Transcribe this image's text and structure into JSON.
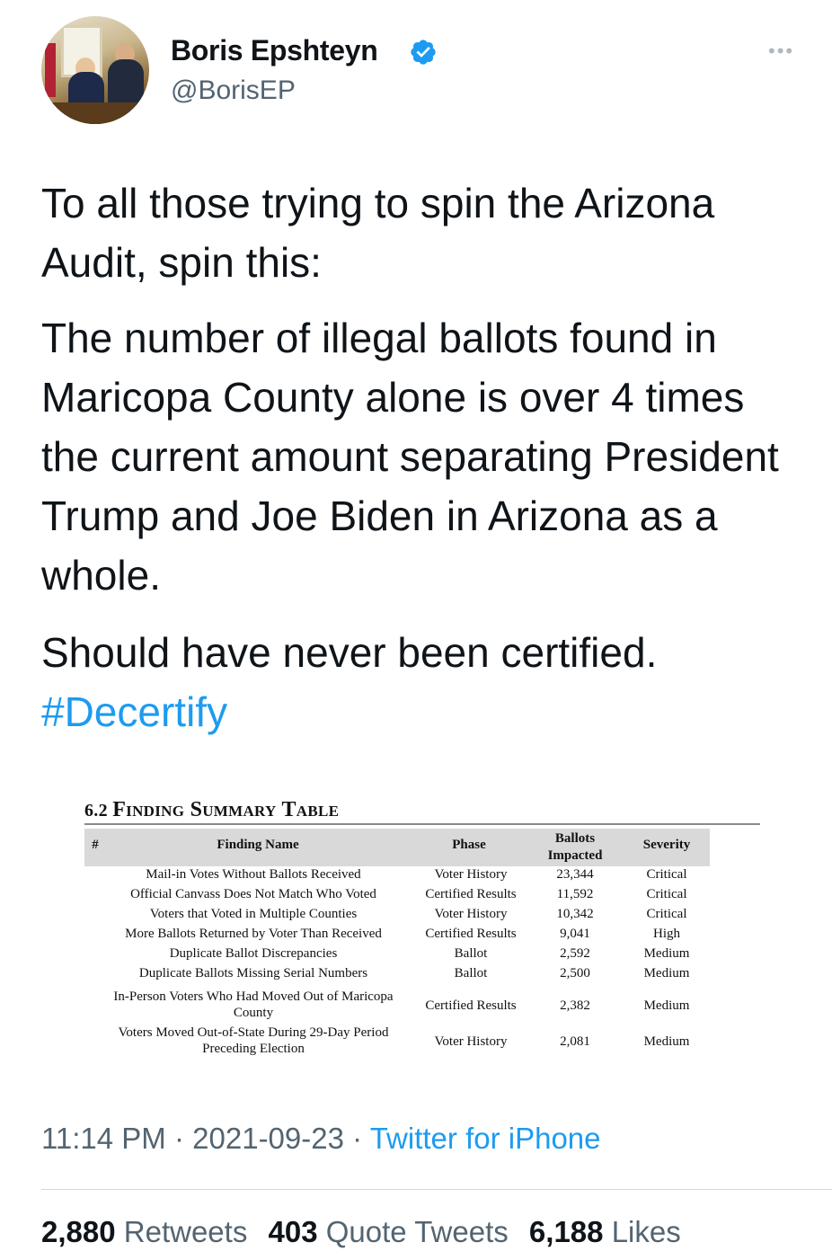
{
  "author": {
    "name": "Boris Epshteyn",
    "handle": "@BorisEP"
  },
  "tweet": {
    "paragraph1": "To all those trying to spin the Arizona Audit, spin this:",
    "paragraph2": "The number of illegal ballots found in Maricopa County alone is over 4 times the current amount separating President Trump and Joe Biden in Arizona as a whole.",
    "paragraph3": "Should have never been certified.",
    "hashtag": "#Decertify"
  },
  "attached_table": {
    "section_number": "6.2",
    "section_title": "Finding Summary Table",
    "headers": {
      "num": "#",
      "finding": "Finding Name",
      "phase": "Phase",
      "ballots": "Ballots Impacted",
      "severity": "Severity"
    },
    "rows": [
      {
        "finding": "Mail-in Votes Without Ballots Received",
        "phase": "Voter History",
        "ballots": "23,344",
        "severity": "Critical"
      },
      {
        "finding": "Official Canvass Does Not Match Who Voted",
        "phase": "Certified Results",
        "ballots": "11,592",
        "severity": "Critical"
      },
      {
        "finding": "Voters that Voted in Multiple Counties",
        "phase": "Voter History",
        "ballots": "10,342",
        "severity": "Critical"
      },
      {
        "finding": "More Ballots Returned by Voter Than Received",
        "phase": "Certified Results",
        "ballots": "9,041",
        "severity": "High"
      },
      {
        "finding": "Duplicate Ballot Discrepancies",
        "phase": "Ballot",
        "ballots": "2,592",
        "severity": "Medium"
      },
      {
        "finding": "Duplicate Ballots Missing Serial Numbers",
        "phase": "Ballot",
        "ballots": "2,500",
        "severity": "Medium"
      },
      {
        "finding": "In-Person Voters Who Had Moved Out of Maricopa County",
        "phase": "Certified Results",
        "ballots": "2,382",
        "severity": "Medium"
      },
      {
        "finding": "Voters Moved Out-of-State During 29-Day Period Preceding Election",
        "phase": "Voter History",
        "ballots": "2,081",
        "severity": "Medium"
      }
    ]
  },
  "meta": {
    "time": "11:14 PM",
    "separator": "·",
    "date": "2021-09-23",
    "source": "Twitter for iPhone"
  },
  "stats": {
    "retweets_count": "2,880",
    "retweets_label": "Retweets",
    "quotes_count": "403",
    "quotes_label": "Quote Tweets",
    "likes_count": "6,188",
    "likes_label": "Likes"
  },
  "colors": {
    "link": "#1d9bf0",
    "secondary_text": "#536471",
    "primary_text": "#0f1419",
    "table_header_bg": "#d9d9d9"
  },
  "icons": {
    "verified": "verified-badge-icon",
    "more": "more-options-icon"
  }
}
